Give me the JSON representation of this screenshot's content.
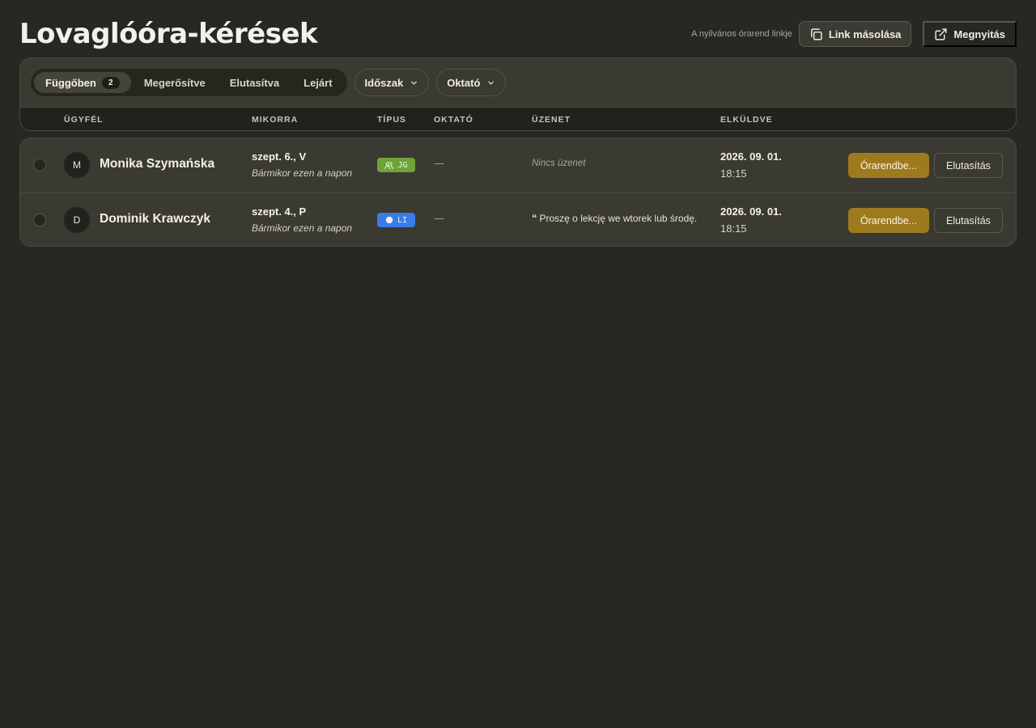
{
  "header": {
    "title": "Lovaglóóra-kérések",
    "link_caption": "A nyilvános órarend linkje",
    "copy_label": "Link másolása",
    "open_label": "Megnyitás"
  },
  "filters": {
    "tabs": [
      {
        "label": "Függőben",
        "count": "2"
      },
      {
        "label": "Megerősítve"
      },
      {
        "label": "Elutasítva"
      },
      {
        "label": "Lejárt"
      }
    ],
    "period_label": "Időszak",
    "instructor_label": "Oktató"
  },
  "columns": {
    "client": "ÜGYFÉL",
    "when": "MIKORRA",
    "type": "TÍPUS",
    "instructor": "OKTATÓ",
    "message": "ÜZENET",
    "sent": "ELKÜLDVE"
  },
  "rows": [
    {
      "initial": "M",
      "name": "Monika Szymańska",
      "date": "szept. 6., V",
      "time_note": "Bármikor ezen a napon",
      "type_code": "JG",
      "type_color": "#6fa33a",
      "instructor": "—",
      "message": "Nincs üzenet",
      "sent_date": "2026. 09. 01.",
      "sent_time": "18:15",
      "schedule_label": "Órarendbe...",
      "reject_label": "Elutasítás"
    },
    {
      "initial": "D",
      "name": "Dominik Krawczyk",
      "date": "szept. 4., P",
      "time_note": "Bármikor ezen a napon",
      "type_code": "LI",
      "type_color": "#3b7be8",
      "instructor": "—",
      "message": "Proszę o lekcję we wtorek lub środę.",
      "sent_date": "2026. 09. 01.",
      "sent_time": "18:15",
      "schedule_label": "Órarendbe...",
      "reject_label": "Elutasítás"
    }
  ]
}
